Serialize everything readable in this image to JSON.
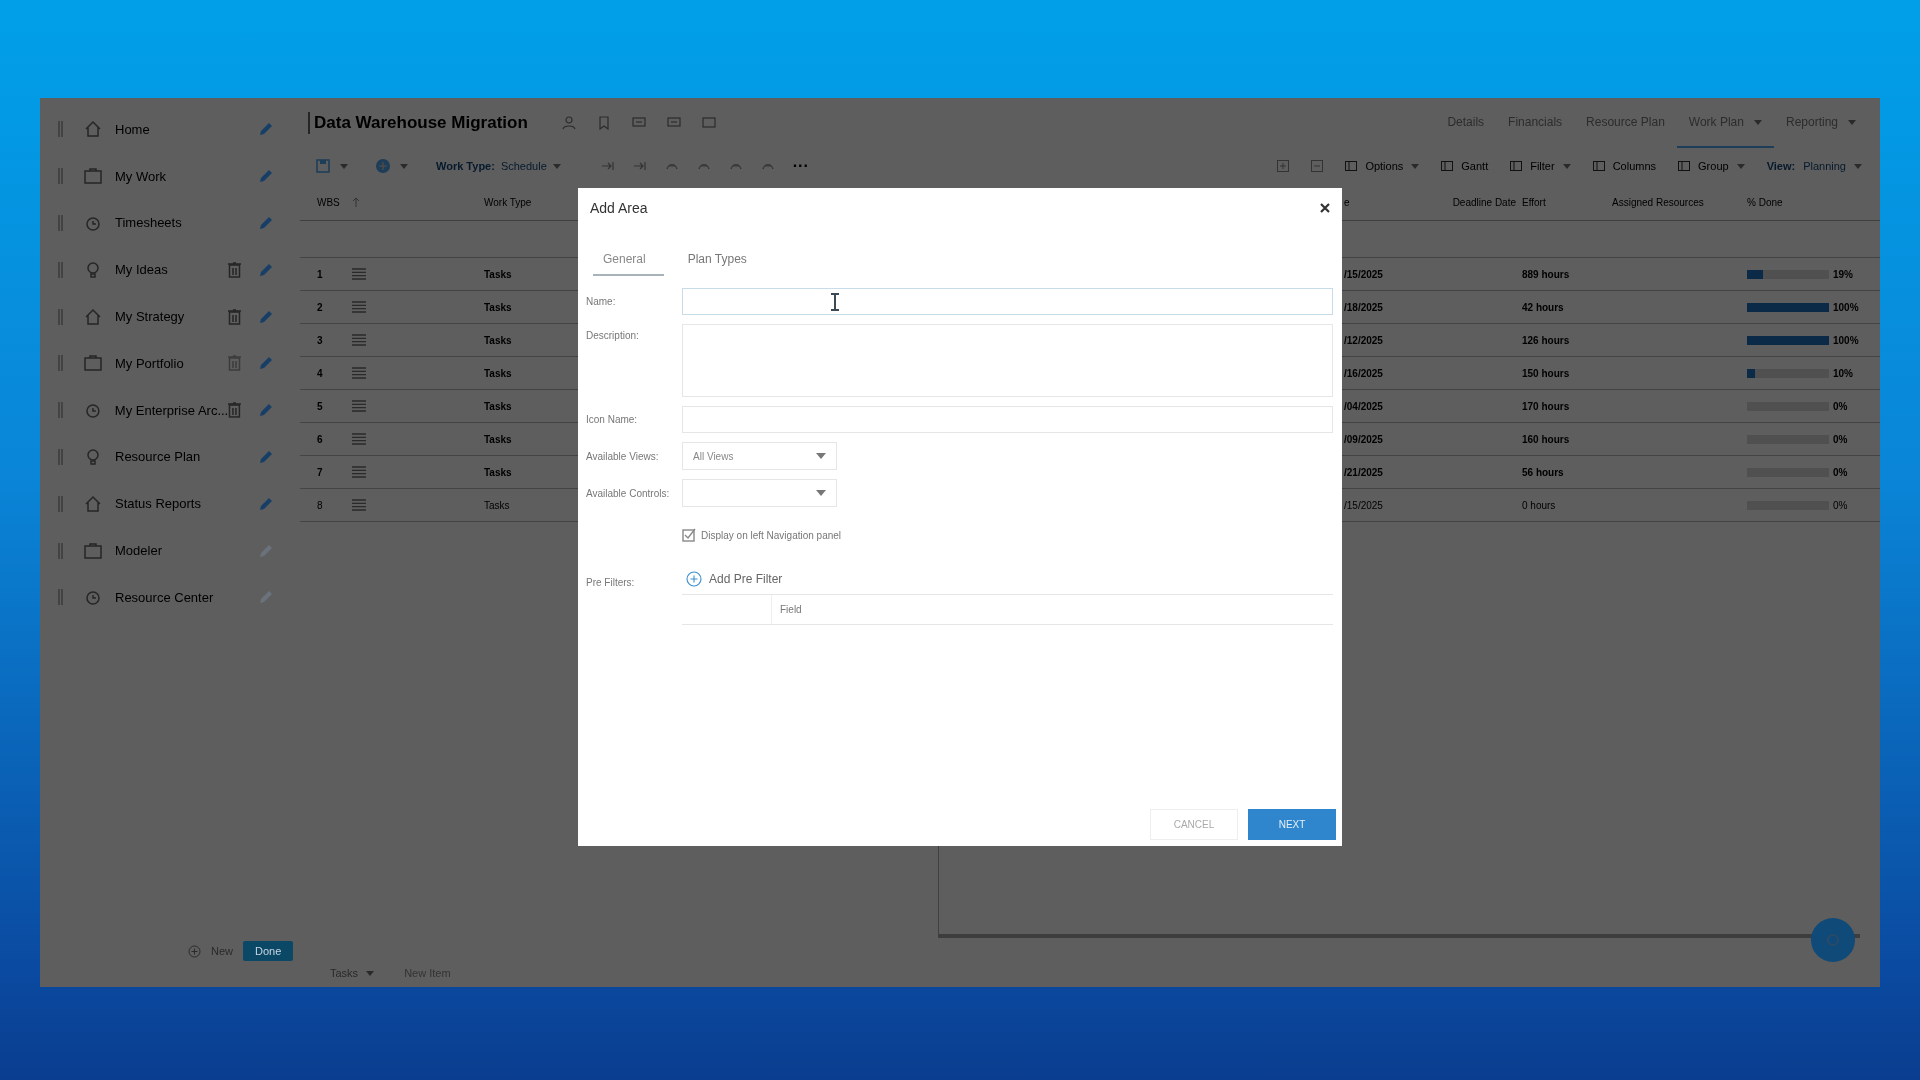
{
  "sidebar": {
    "items": [
      {
        "label": "Home",
        "deletable": false,
        "edit_disabled": false
      },
      {
        "label": "My Work",
        "deletable": false,
        "edit_disabled": false
      },
      {
        "label": "Timesheets",
        "deletable": false,
        "edit_disabled": false
      },
      {
        "label": "My Ideas",
        "deletable": true,
        "delete_disabled": false,
        "edit_disabled": false
      },
      {
        "label": "My Strategy",
        "deletable": true,
        "delete_disabled": false,
        "edit_disabled": false
      },
      {
        "label": "My Portfolio",
        "deletable": true,
        "delete_disabled": true,
        "edit_disabled": false
      },
      {
        "label": "My Enterprise Arc...",
        "deletable": true,
        "delete_disabled": false,
        "edit_disabled": false
      },
      {
        "label": "Resource Plan",
        "deletable": false,
        "edit_disabled": false
      },
      {
        "label": "Status Reports",
        "deletable": false,
        "edit_disabled": false
      },
      {
        "label": "Modeler",
        "deletable": false,
        "edit_disabled": true
      },
      {
        "label": "Resource Center",
        "deletable": false,
        "edit_disabled": true
      }
    ],
    "footer": {
      "new_label": "New",
      "done_label": "Done"
    }
  },
  "header": {
    "title": "Data Warehouse Migration",
    "nav_tabs": [
      {
        "label": "Details",
        "selected": false,
        "has_menu": false
      },
      {
        "label": "Financials",
        "selected": false,
        "has_menu": false
      },
      {
        "label": "Resource Plan",
        "selected": false,
        "has_menu": false
      },
      {
        "label": "Work Plan",
        "selected": true,
        "has_menu": true
      },
      {
        "label": "Reporting",
        "selected": false,
        "has_menu": true
      }
    ]
  },
  "toolbar": {
    "work_type_label": "Work Type:",
    "work_type_value": "Schedule",
    "more": "···",
    "right_items": [
      {
        "label": "Options",
        "has_menu": true
      },
      {
        "label": "Gantt",
        "has_menu": false
      },
      {
        "label": "Filter",
        "has_menu": true
      },
      {
        "label": "Columns",
        "has_menu": false
      },
      {
        "label": "Group",
        "has_menu": true
      }
    ],
    "view_label": "View:",
    "view_value": "Planning"
  },
  "table": {
    "columns": [
      "WBS",
      "Work Type",
      "e",
      "Deadline Date",
      "Effort",
      "Assigned Resources",
      "% Done"
    ],
    "rows": [
      {
        "wbs": "1",
        "work_type": "Tasks",
        "column_3": "/15/2025",
        "effort": "889 hours",
        "level": 0.19,
        "reading": "19%",
        "bold": true
      },
      {
        "wbs": "2",
        "work_type": "Tasks",
        "column_3": "/18/2025",
        "effort": "42 hours",
        "level": 1,
        "reading": "100%",
        "bold": true
      },
      {
        "wbs": "3",
        "work_type": "Tasks",
        "column_3": "/12/2025",
        "effort": "126 hours",
        "level": 1,
        "reading": "100%",
        "bold": true
      },
      {
        "wbs": "4",
        "work_type": "Tasks",
        "column_3": "/16/2025",
        "effort": "150 hours",
        "level": 0.1,
        "reading": "10%",
        "bold": true
      },
      {
        "wbs": "5",
        "work_type": "Tasks",
        "column_3": "/04/2025",
        "effort": "170 hours",
        "level": 0,
        "reading": "0%",
        "bold": true
      },
      {
        "wbs": "6",
        "work_type": "Tasks",
        "column_3": "/09/2025",
        "effort": "160 hours",
        "level": 0,
        "reading": "0%",
        "bold": true
      },
      {
        "wbs": "7",
        "work_type": "Tasks",
        "column_3": "/21/2025",
        "effort": "56 hours",
        "level": 0,
        "reading": "0%",
        "bold": true
      },
      {
        "wbs": "8",
        "work_type": "Tasks",
        "column_3": "/15/2025",
        "effort": "0 hours",
        "level": 0,
        "reading": "0%",
        "bold": false
      }
    ]
  },
  "bottom_bar": {
    "tasks_label": "Tasks",
    "new_item_label": "New Item"
  },
  "dialog": {
    "title": "Add Area",
    "tabs": [
      {
        "label": "General",
        "selected": true
      },
      {
        "label": "Plan Types",
        "selected": false
      }
    ],
    "name_label": "Name:",
    "description_label": "Description:",
    "icon_name_label": "Icon Name:",
    "views_label": "Available Views:",
    "views_value": "All Views",
    "controls_label": "Available Controls:",
    "display_nav": {
      "label": "Display on left Navigation panel",
      "checked": true
    },
    "pre_filters_label": "Pre Filters:",
    "add_pre_filter": "Add Pre Filter",
    "filter_column": "Field",
    "cancel": "CANCEL",
    "next": "NEXT"
  }
}
